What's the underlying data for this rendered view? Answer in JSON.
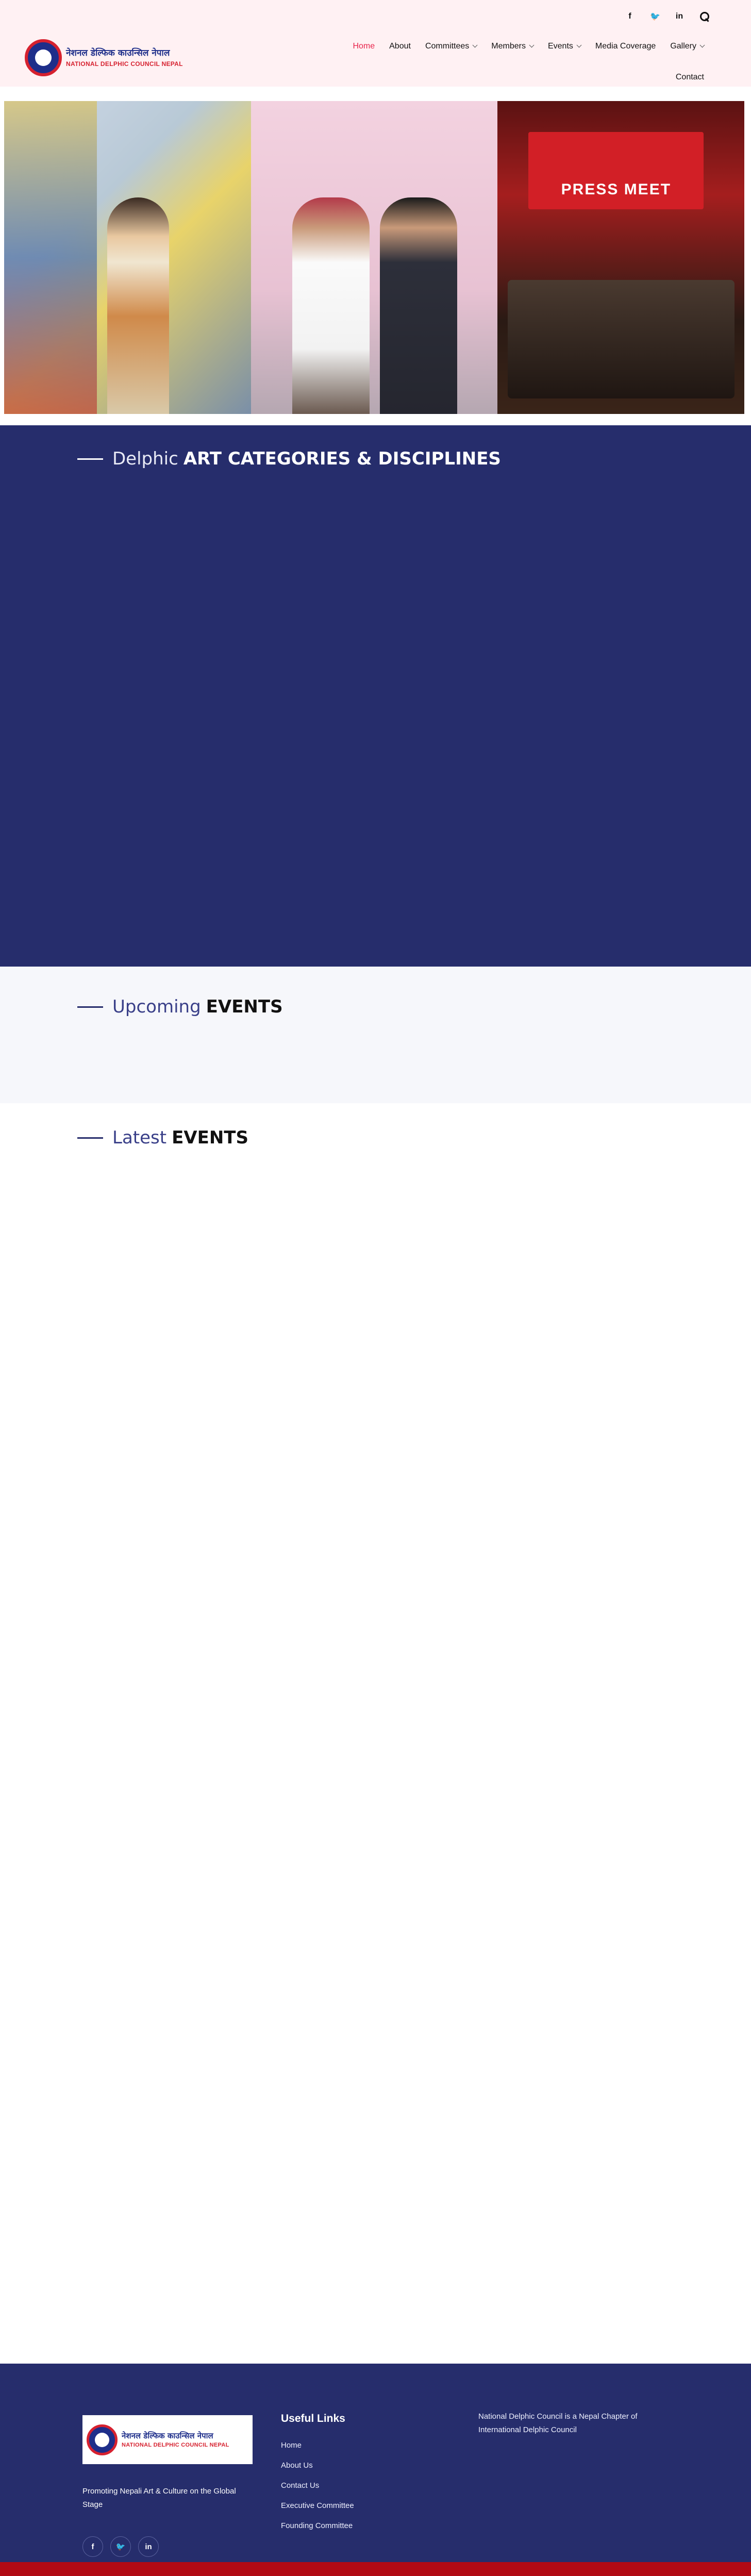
{
  "header": {
    "social": [
      {
        "icon": "facebook-icon",
        "glyph": "f"
      },
      {
        "icon": "twitter-icon",
        "glyph": "🐦"
      },
      {
        "icon": "linkedin-icon",
        "glyph": "in"
      }
    ],
    "logo": {
      "nepali": "नेशनल डेल्फिक काउन्सिल नेपाल",
      "english": "NATIONAL DELPHIC COUNCIL NEPAL"
    },
    "nav": [
      {
        "label": "Home",
        "active": true
      },
      {
        "label": "About",
        "dropdown": false
      },
      {
        "label": "Committees",
        "dropdown": true
      },
      {
        "label": "Members",
        "dropdown": true
      },
      {
        "label": "Events",
        "dropdown": true
      },
      {
        "label": "Media Coverage",
        "dropdown": false
      },
      {
        "label": "Gallery",
        "dropdown": true
      },
      {
        "label": "Contact",
        "dropdown": false
      }
    ]
  },
  "banner": {
    "press_text": "PRESS MEET"
  },
  "sections": {
    "art": {
      "light": "Delphic",
      "bold": "ART CATEGORIES & DISCIPLINES"
    },
    "upcoming": {
      "light": "Upcoming",
      "bold": "EVENTS"
    },
    "latest": {
      "light": "Latest",
      "bold": "EVENTS"
    }
  },
  "footer": {
    "tagline": "Promoting Nepali Art & Culture on the Global Stage",
    "useful_links_title": "Useful Links",
    "useful_links": [
      "Home",
      "About Us",
      "Contact Us",
      "Executive Committee",
      "Founding Committee"
    ],
    "about": "National Delphic Council is a Nepal Chapter of International Delphic Council",
    "social": [
      {
        "icon": "facebook-icon",
        "glyph": "f"
      },
      {
        "icon": "twitter-icon",
        "glyph": "🐦"
      },
      {
        "icon": "linkedin-icon",
        "glyph": "in"
      }
    ]
  },
  "colors": {
    "primary": "#262d6c",
    "accent": "#e8244b",
    "header_bg": "#fff1f3",
    "footer_bar": "#b20a14"
  }
}
